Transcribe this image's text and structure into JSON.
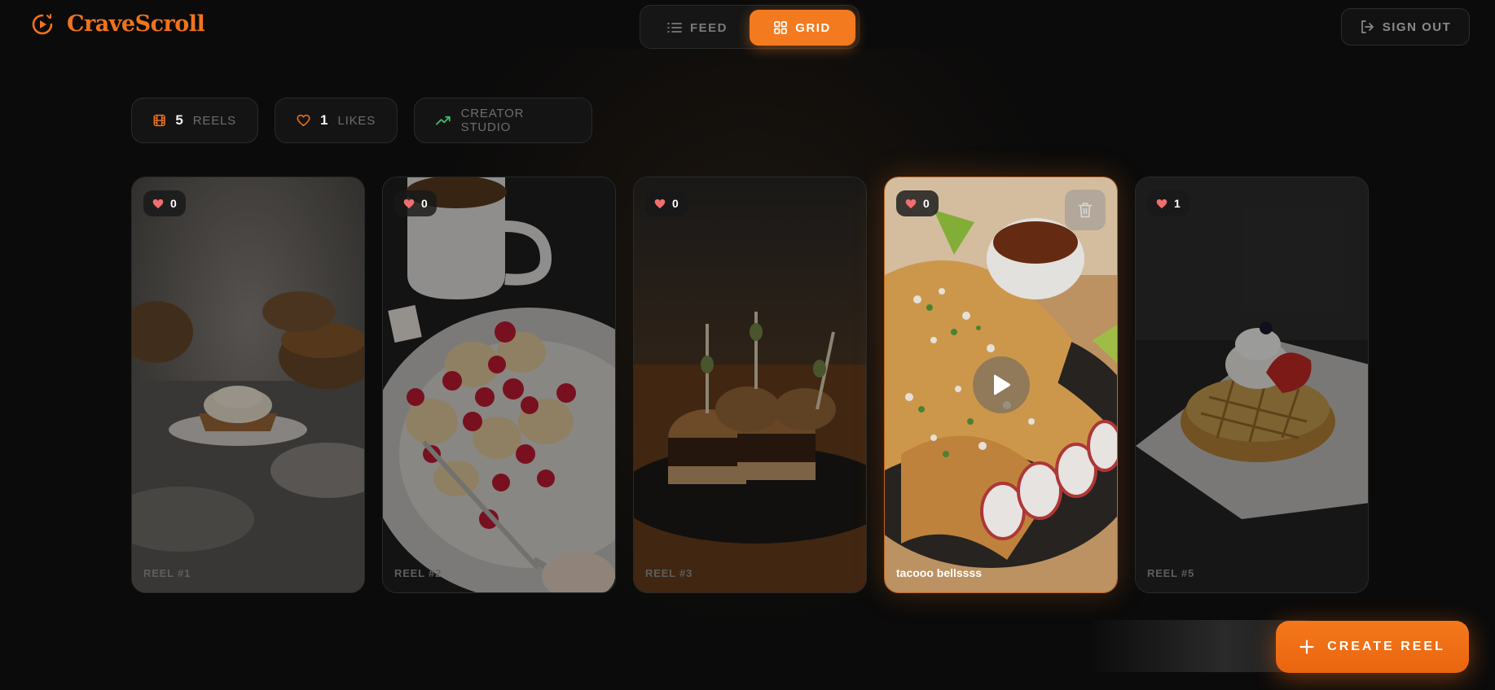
{
  "app": {
    "name": "CraveScroll"
  },
  "view_toggle": {
    "feed_label": "FEED",
    "grid_label": "GRID",
    "active": "grid"
  },
  "header": {
    "signout_label": "SIGN OUT"
  },
  "stats": {
    "reels_count": "5",
    "reels_label": "REELS",
    "likes_count": "1",
    "likes_label": "LIKES",
    "studio_label": "CREATOR STUDIO"
  },
  "reels": [
    {
      "likes": "0",
      "label": "REEL #1"
    },
    {
      "likes": "0",
      "label": "REEL #2"
    },
    {
      "likes": "0",
      "label": "REEL #3"
    },
    {
      "likes": "0",
      "label": "tacooo bellssss"
    },
    {
      "likes": "1",
      "label": "REEL #5"
    }
  ],
  "create_button": {
    "label": "CREATE REEL"
  },
  "colors": {
    "accent": "#f47a1f",
    "background": "#0b0b0b",
    "heart": "#f26d6d",
    "studio_icon": "#3fbf6a"
  }
}
